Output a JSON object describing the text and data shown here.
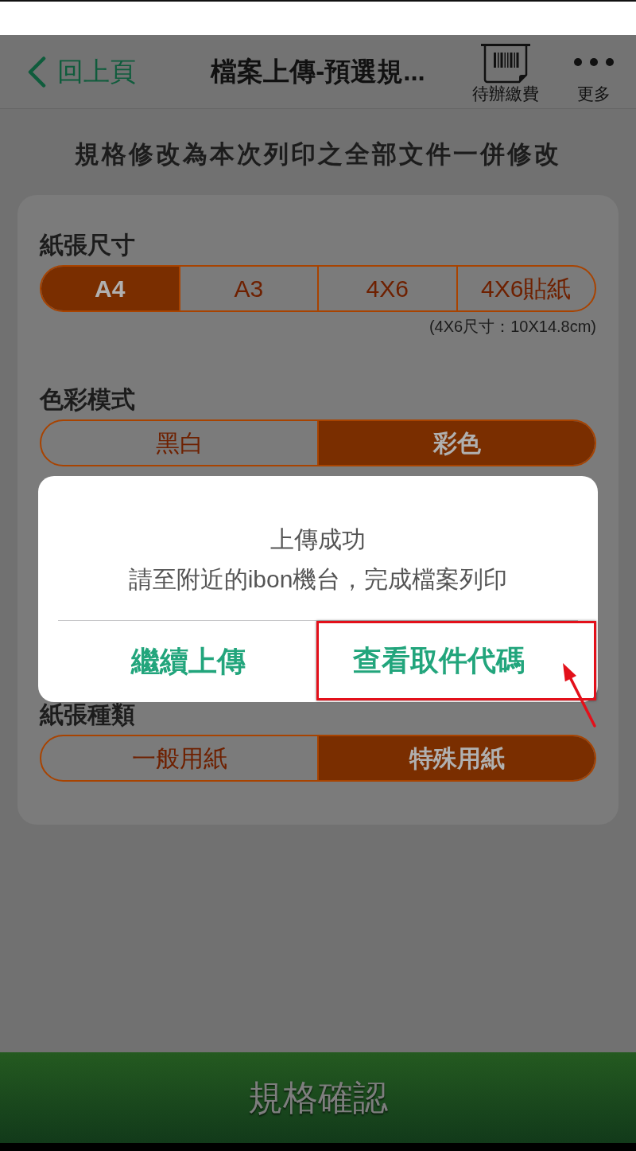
{
  "nav_bar": {
    "back_label": "回上頁",
    "title": "檔案上傳-預選規...",
    "actions": [
      {
        "kind": "barcode",
        "label": "待辦繳費"
      },
      {
        "kind": "more",
        "label": "更多"
      }
    ]
  },
  "notice": "規格修改為本次列印之全部文件一併修改",
  "sections": [
    {
      "title": "紙張尺寸",
      "options": [
        {
          "label": "A4",
          "selected": true
        },
        {
          "label": "A3",
          "selected": false
        },
        {
          "label": "4X6",
          "selected": false
        },
        {
          "label": "4X6貼紙",
          "selected": false
        }
      ],
      "note": "(4X6尺寸：10X14.8cm)"
    },
    {
      "title": "色彩模式",
      "options": [
        {
          "label": "黑白",
          "selected": false
        },
        {
          "label": "彩色",
          "selected": true
        }
      ]
    },
    {
      "title": "紙張種類",
      "options": [
        {
          "label": "一般用紙",
          "selected": false
        },
        {
          "label": "特殊用紙",
          "selected": true
        }
      ]
    }
  ],
  "dialog": {
    "title": "上傳成功",
    "message": "請至附近的ibon機台，完成檔案列印",
    "buttons": [
      {
        "label": "繼續上傳",
        "highlighted": false
      },
      {
        "label": "查看取件代碼",
        "highlighted": true
      }
    ]
  },
  "confirm_button": "規格確認"
}
